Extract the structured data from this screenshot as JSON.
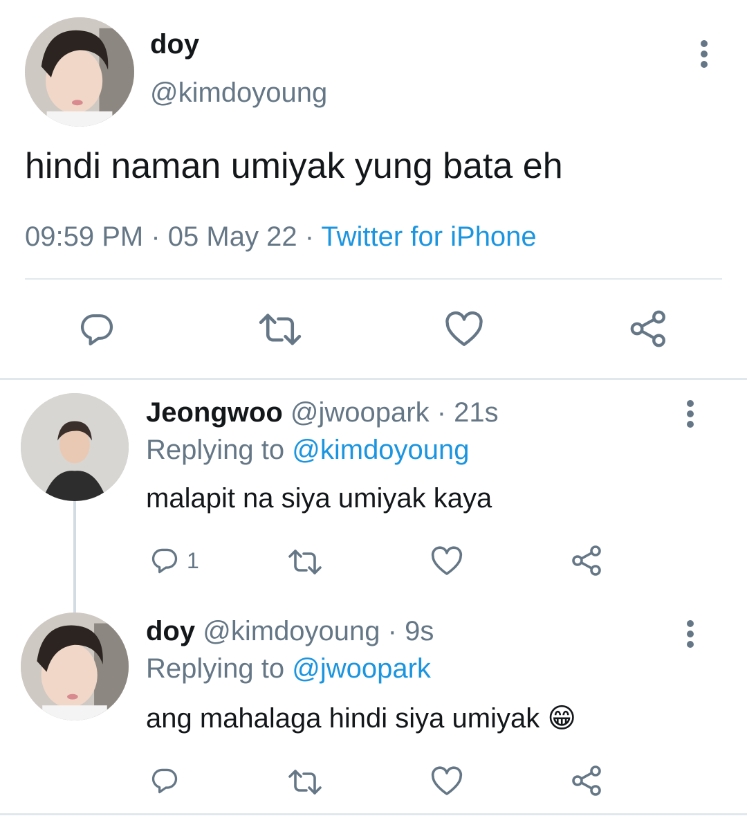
{
  "main_tweet": {
    "display_name": "doy",
    "handle": "@kimdoyoung",
    "text": "hindi naman umiyak yung bata eh",
    "time": "09:59 PM",
    "date": "05 May 22",
    "separator": "·",
    "source": "Twitter for iPhone"
  },
  "replies": [
    {
      "display_name": "Jeongwoo",
      "handle": "@jwoopark",
      "age": "21s",
      "separator": "·",
      "replying_to_label": "Replying to",
      "replying_to_handle": "@kimdoyoung",
      "text": "malapit na siya umiyak kaya",
      "reply_count": "1"
    },
    {
      "display_name": "doy",
      "handle": "@kimdoyoung",
      "age": "9s",
      "separator": "·",
      "replying_to_label": "Replying to",
      "replying_to_handle": "@jwoopark",
      "text": "ang mahalaga hindi siya umiyak",
      "emoji": "😁",
      "reply_count": ""
    }
  ],
  "icons": [
    "reply-icon",
    "retweet-icon",
    "like-icon",
    "share-icon",
    "more-options-icon"
  ],
  "colors": {
    "text": "#14171a",
    "secondary": "#657786",
    "link": "#1b95e0",
    "divider": "#e1e8ed"
  }
}
